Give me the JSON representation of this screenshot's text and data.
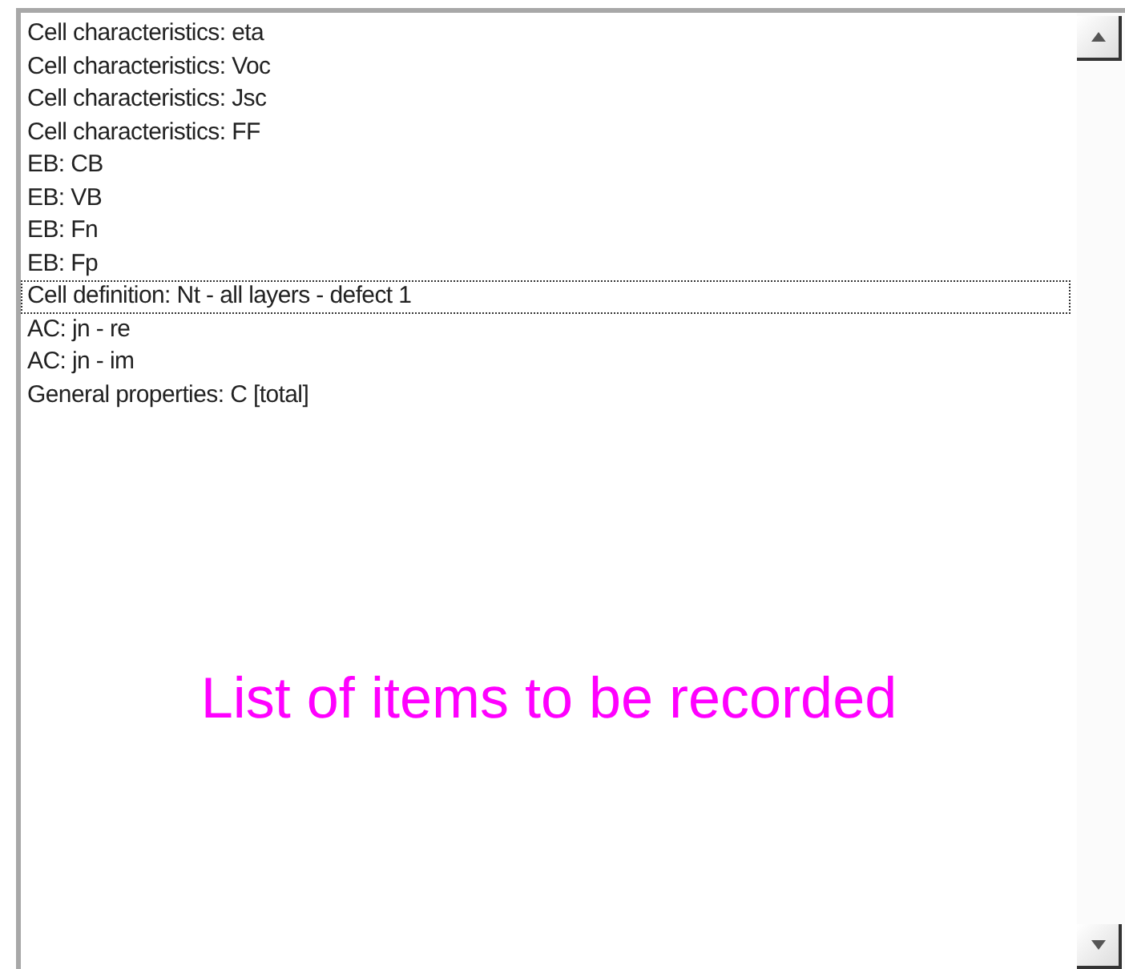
{
  "list_box": {
    "items": [
      {
        "label": "Cell characteristics: eta",
        "focused": false
      },
      {
        "label": "Cell characteristics: Voc",
        "focused": false
      },
      {
        "label": "Cell characteristics: Jsc",
        "focused": false
      },
      {
        "label": "Cell characteristics: FF",
        "focused": false
      },
      {
        "label": "EB: CB",
        "focused": false
      },
      {
        "label": "EB: VB",
        "focused": false
      },
      {
        "label": "EB: Fn",
        "focused": false
      },
      {
        "label": "EB: Fp",
        "focused": false
      },
      {
        "label": "Cell definition: Nt - all layers - defect 1",
        "focused": true
      },
      {
        "label": "AC: jn - re",
        "focused": false
      },
      {
        "label": "AC: jn - im",
        "focused": false
      },
      {
        "label": "General properties: C [total]",
        "focused": false
      }
    ]
  },
  "annotation": "List of items to be recorded"
}
